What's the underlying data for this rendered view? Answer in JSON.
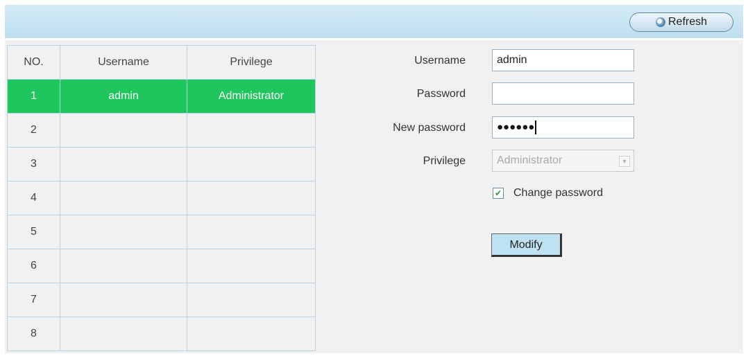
{
  "toolbar": {
    "refresh_label": "Refresh"
  },
  "table": {
    "headers": {
      "no": "NO.",
      "username": "Username",
      "privilege": "Privilege"
    },
    "rows": [
      {
        "no": "1",
        "username": "admin",
        "privilege": "Administrator",
        "selected": true
      },
      {
        "no": "2",
        "username": "",
        "privilege": ""
      },
      {
        "no": "3",
        "username": "",
        "privilege": ""
      },
      {
        "no": "4",
        "username": "",
        "privilege": ""
      },
      {
        "no": "5",
        "username": "",
        "privilege": ""
      },
      {
        "no": "6",
        "username": "",
        "privilege": ""
      },
      {
        "no": "7",
        "username": "",
        "privilege": ""
      },
      {
        "no": "8",
        "username": "",
        "privilege": ""
      }
    ]
  },
  "form": {
    "username_label": "Username",
    "username_value": "admin",
    "password_label": "Password",
    "password_value": "",
    "new_password_label": "New password",
    "new_password_dots": "●●●●●●",
    "privilege_label": "Privilege",
    "privilege_value": "Administrator",
    "change_password_label": "Change password",
    "change_password_checked": true,
    "modify_label": "Modify"
  },
  "colors": {
    "selected_row": "#1ec65d",
    "topbar": "#c9e6f4",
    "button": "#bfe2f2"
  },
  "icons": {
    "refresh": "refresh-icon",
    "dropdown": "chevron-down-icon",
    "check": "checkmark-icon"
  }
}
